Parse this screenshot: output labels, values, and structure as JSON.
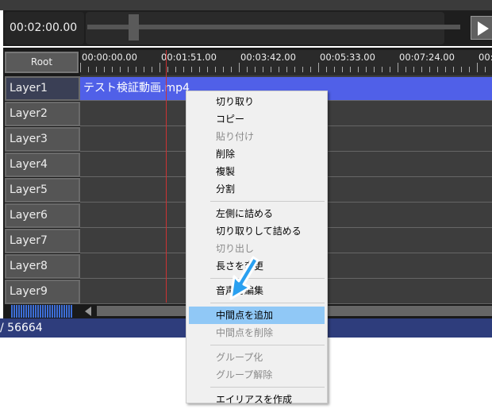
{
  "transport": {
    "current_time": "00:02:00.00",
    "seek_fraction": 0.12
  },
  "timeline": {
    "root_label": "Root",
    "ruler_ticks": [
      "00:00:00.00",
      "00:01:51.00",
      "00:03:42.00",
      "00:05:33.00",
      "00:07:24.00",
      "00:0"
    ],
    "layers": [
      "Layer1",
      "Layer2",
      "Layer3",
      "Layer4",
      "Layer5",
      "Layer6",
      "Layer7",
      "Layer8",
      "Layer9"
    ],
    "clip_name": "テスト検証動画.mp4"
  },
  "status": {
    "text": "/ 56664"
  },
  "context_menu": {
    "groups": [
      [
        {
          "label": "切り取り",
          "enabled": true
        },
        {
          "label": "コピー",
          "enabled": true
        },
        {
          "label": "貼り付け",
          "enabled": false
        },
        {
          "label": "削除",
          "enabled": true
        },
        {
          "label": "複製",
          "enabled": true
        },
        {
          "label": "分割",
          "enabled": true
        }
      ],
      [
        {
          "label": "左側に詰める",
          "enabled": true
        },
        {
          "label": "切り取りして詰める",
          "enabled": true
        },
        {
          "label": "切り出し",
          "enabled": false
        },
        {
          "label": "長さを変更",
          "enabled": true
        }
      ],
      [
        {
          "label": "音声を編集",
          "enabled": true
        }
      ],
      [
        {
          "label": "中間点を追加",
          "enabled": true,
          "highlighted": true
        },
        {
          "label": "中間点を削除",
          "enabled": false
        }
      ],
      [
        {
          "label": "グループ化",
          "enabled": false
        },
        {
          "label": "グループ解除",
          "enabled": false
        }
      ],
      [
        {
          "label": "エイリアスを作成",
          "enabled": true
        }
      ]
    ]
  },
  "colors": {
    "clip": "#5060e8",
    "highlight": "#90c8f6",
    "playhead": "#cc3333",
    "status_bar": "#2e3d7c",
    "annotation_arrow": "#2aa0f0"
  }
}
